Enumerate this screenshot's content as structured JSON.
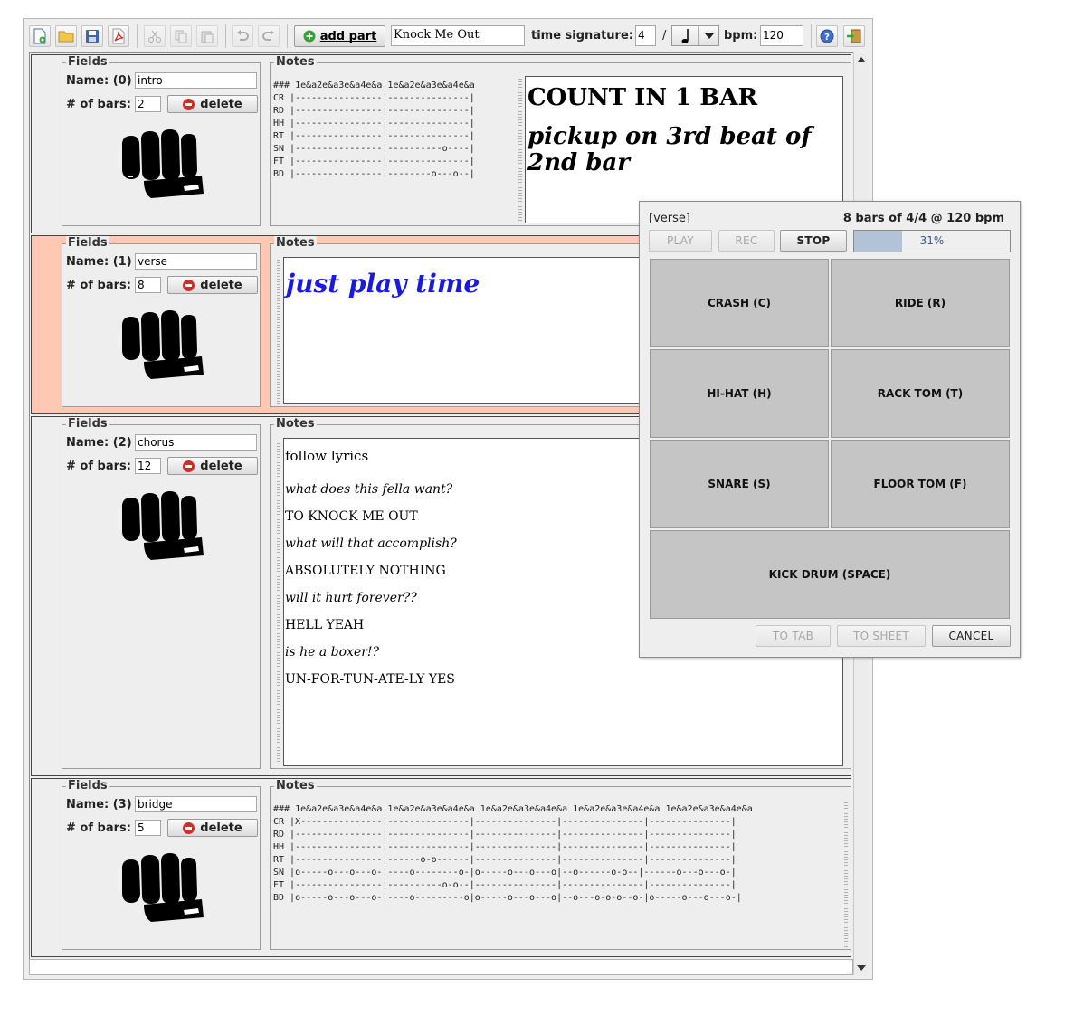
{
  "toolbar": {
    "add_part_label": "add part",
    "song_title": "Knock Me Out",
    "time_sig_label": "time signature:",
    "time_sig_num": "4",
    "slash": "/",
    "bpm_label": "bpm:",
    "bpm_value": "120"
  },
  "field_labels": {
    "fields_title": "Fields",
    "bars_label": "# of bars:",
    "delete_label": "delete",
    "notes_title": "Notes"
  },
  "parts": [
    {
      "name_label": "Name: (0)",
      "name": "intro",
      "bars": "2",
      "tab": "### 1e&a2e&a3e&a4e&a 1e&a2e&a3e&a4e&a\nCR |----------------|---------------|\nRD |----------------|---------------|\nHH |----------------|---------------|\nRT |----------------|---------------|\nSN |----------------|----------o----|\nFT |----------------|---------------|\nBD |----------------|--------o---o--|",
      "note_heading": "COUNT IN 1 BAR",
      "note_sub": "pickup on 3rd beat of 2nd bar"
    },
    {
      "name_label": "Name: (1)",
      "name": "verse",
      "bars": "8",
      "note_text": "just play time"
    },
    {
      "name_label": "Name: (2)",
      "name": "chorus",
      "bars": "12",
      "lyrics": [
        "follow lyrics",
        "what does this fella want?",
        "TO KNOCK ME OUT",
        "what will that accomplish?",
        "ABSOLUTELY NOTHING",
        "will it hurt forever??",
        "HELL YEAH",
        "is he a boxer!?",
        "UN-FOR-TUN-ATE-LY YES"
      ]
    },
    {
      "name_label": "Name: (3)",
      "name": "bridge",
      "bars": "5",
      "tab": "### 1e&a2e&a3e&a4e&a 1e&a2e&a3e&a4e&a 1e&a2e&a3e&a4e&a 1e&a2e&a3e&a4e&a 1e&a2e&a3e&a4e&a\nCR |X---------------|---------------|---------------|---------------|---------------|\nRD |----------------|---------------|---------------|---------------|---------------|\nHH |----------------|---------------|---------------|---------------|---------------|\nRT |----------------|------o-o------|---------------|---------------|---------------|\nSN |o-----o---o---o-|----o--------o-|o-----o---o---o|--o------o-o--|------o---o---o-|\nFT |----------------|----------o-o--|---------------|---------------|---------------|\nBD |o-----o---o---o-|----o---------o|o-----o---o---o|--o---o-o-o--o-|o-----o---o---o-|"
    }
  ],
  "dialog": {
    "section": "[verse]",
    "info": "8 bars of 4/4 @  120 bpm",
    "play": "PLAY",
    "rec": "REC",
    "stop": "STOP",
    "progress_pct": 31,
    "progress_text": "31%",
    "pads": [
      "CRASH (C)",
      "RIDE (R)",
      "HI-HAT (H)",
      "RACK TOM (T)",
      "SNARE (S)",
      "FLOOR TOM (F)",
      "KICK DRUM (SPACE)"
    ],
    "to_tab": "TO TAB",
    "to_sheet": "TO SHEET",
    "cancel": "CANCEL"
  },
  "colors": {
    "selected_part": "#ffc8b3",
    "verse_note": "#1a1adc",
    "delete_icon": "#d42a2a",
    "progress_fill": "#b3c3d7"
  }
}
